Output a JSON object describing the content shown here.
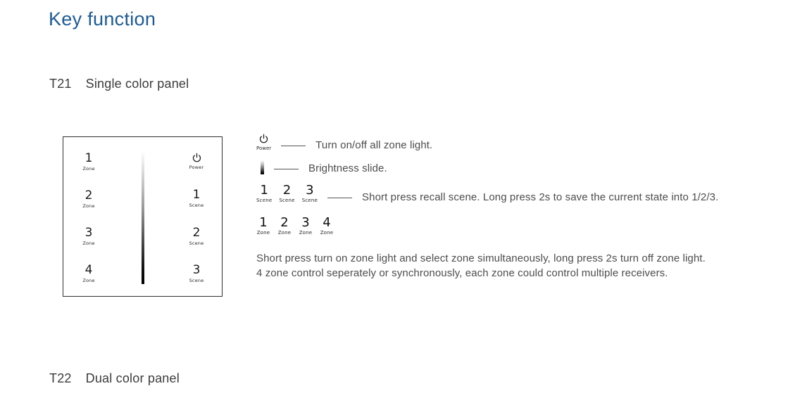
{
  "page": {
    "heading": "Key function",
    "heading_color": "#1d5a96",
    "body_text_color": "#4d4d4d",
    "background": "#ffffff"
  },
  "sections": [
    {
      "code": "T21",
      "name": "Single color panel"
    },
    {
      "code": "T22",
      "name": "Dual color panel"
    }
  ],
  "device_panel": {
    "left_keys": [
      {
        "num": "1",
        "sub": "Zone"
      },
      {
        "num": "2",
        "sub": "Zone"
      },
      {
        "num": "3",
        "sub": "Zone"
      },
      {
        "num": "4",
        "sub": "Zone"
      }
    ],
    "right_keys": [
      {
        "icon": "power-icon",
        "sub": "Power"
      },
      {
        "num": "1",
        "sub": "Scene"
      },
      {
        "num": "2",
        "sub": "Scene"
      },
      {
        "num": "3",
        "sub": "Scene"
      }
    ],
    "slider": {
      "name": "brightness-slider",
      "gradient_top": "#fdfdfd",
      "gradient_bottom": "#000000"
    }
  },
  "legend": {
    "power_row": {
      "icon": "power-icon",
      "sub": "Power",
      "description": "Turn on/off all zone light."
    },
    "brightness_row": {
      "icon": "brightness-gradient-icon",
      "description": "Brightness slide."
    },
    "scene_row": {
      "keys": [
        {
          "num": "1",
          "sub": "Scene"
        },
        {
          "num": "2",
          "sub": "Scene"
        },
        {
          "num": "3",
          "sub": "Scene"
        }
      ],
      "description": "Short press recall scene. Long press 2s to save the current state into 1/2/3."
    },
    "zone_row": {
      "keys": [
        {
          "num": "1",
          "sub": "Zone"
        },
        {
          "num": "2",
          "sub": "Zone"
        },
        {
          "num": "3",
          "sub": "Zone"
        },
        {
          "num": "4",
          "sub": "Zone"
        }
      ]
    },
    "paragraph": {
      "line1": "Short press turn on zone light and select zone simultaneously, long press 2s turn off zone light.",
      "line2": "4 zone control seperately or synchronously, each zone could control multiple receivers."
    }
  }
}
